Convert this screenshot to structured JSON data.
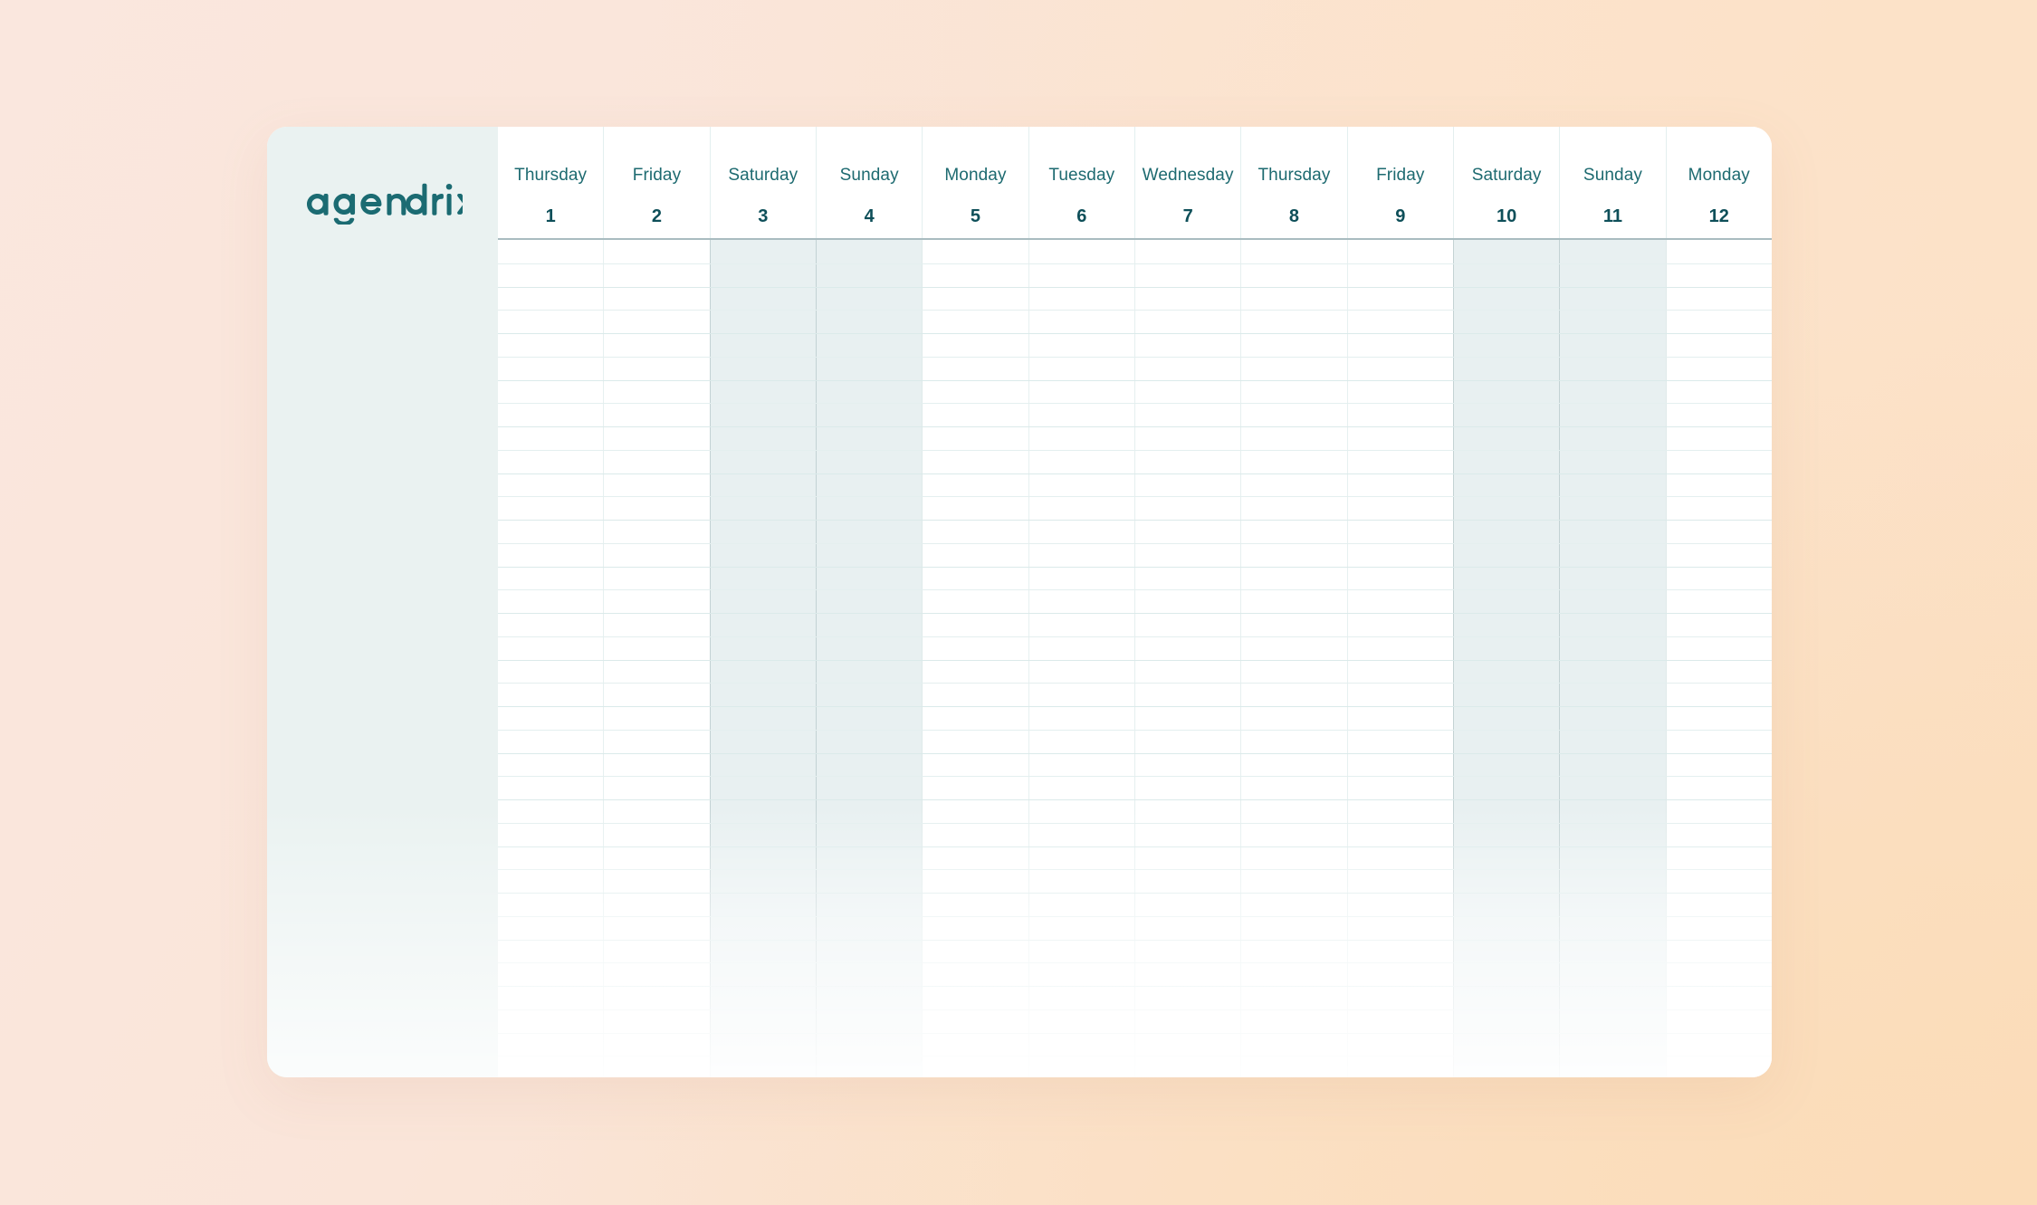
{
  "brand": {
    "name": "agendrix",
    "logo_color": "#1b6b72"
  },
  "colors": {
    "sidebar_bg": "#eaf2f1",
    "card_bg": "#ffffff",
    "day_name": "#1d6a70",
    "day_number": "#0e4f59",
    "weekend_bg": "#e8f0f1",
    "grid_line": "#e4efef",
    "header_border": "#a9bcc0",
    "page_bg_start": "#fae7de",
    "page_bg_end": "#fbdfc2"
  },
  "calendar": {
    "days": [
      {
        "name": "Thursday",
        "number": "1",
        "weekend": false
      },
      {
        "name": "Friday",
        "number": "2",
        "weekend": false
      },
      {
        "name": "Saturday",
        "number": "3",
        "weekend": true
      },
      {
        "name": "Sunday",
        "number": "4",
        "weekend": true
      },
      {
        "name": "Monday",
        "number": "5",
        "weekend": false
      },
      {
        "name": "Tuesday",
        "number": "6",
        "weekend": false
      },
      {
        "name": "Wednesday",
        "number": "7",
        "weekend": false
      },
      {
        "name": "Thursday",
        "number": "8",
        "weekend": false
      },
      {
        "name": "Friday",
        "number": "9",
        "weekend": false
      },
      {
        "name": "Saturday",
        "number": "10",
        "weekend": true
      },
      {
        "name": "Sunday",
        "number": "11",
        "weekend": true
      },
      {
        "name": "Monday",
        "number": "12",
        "weekend": false
      }
    ],
    "row_count": 36
  }
}
